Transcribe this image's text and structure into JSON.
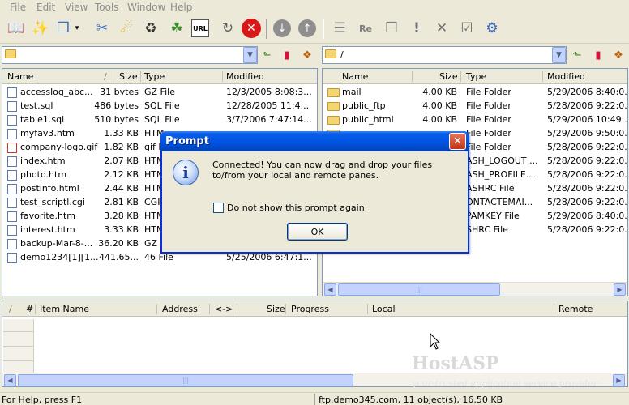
{
  "menu": [
    "File",
    "Edit",
    "View",
    "Tools",
    "Window",
    "Help"
  ],
  "toolbar_icons": [
    "connect-icon",
    "wizard-icon",
    "new-icon",
    "disconnect-icon",
    "stop-link-icon",
    "sync-icon",
    "browse-icon",
    "url-icon",
    "refresh-icon",
    "abort-icon",
    "download-icon",
    "upload-icon",
    "properties-icon",
    "rename-icon",
    "newfolder-icon",
    "exclamation-icon",
    "delete-icon",
    "check-icon",
    "settings-icon"
  ],
  "local": {
    "path": "",
    "columns": {
      "name": "Name",
      "sort": "/",
      "size": "Size",
      "type": "Type",
      "modified": "Modified"
    },
    "files": [
      {
        "name": "accesslog_abc...",
        "size": "31 bytes",
        "type": "GZ File",
        "modified": "12/3/2005 8:08:3...",
        "icon": "file"
      },
      {
        "name": "test.sql",
        "size": "486 bytes",
        "type": "SQL File",
        "modified": "12/28/2005 11:4...",
        "icon": "file"
      },
      {
        "name": "table1.sql",
        "size": "510 bytes",
        "type": "SQL File",
        "modified": "3/7/2006 7:47:14...",
        "icon": "file"
      },
      {
        "name": "myfav3.htm",
        "size": "1.33 KB",
        "type": "HTM",
        "modified": "",
        "icon": "html"
      },
      {
        "name": "company-logo.gif",
        "size": "1.82 KB",
        "type": "gif I",
        "modified": "",
        "icon": "gif"
      },
      {
        "name": "index.htm",
        "size": "2.07 KB",
        "type": "HTM",
        "modified": "",
        "icon": "html"
      },
      {
        "name": "photo.htm",
        "size": "2.12 KB",
        "type": "HTM",
        "modified": "",
        "icon": "html"
      },
      {
        "name": "postinfo.html",
        "size": "2.44 KB",
        "type": "HTM",
        "modified": "",
        "icon": "html"
      },
      {
        "name": "test_scriptl.cgi",
        "size": "2.81 KB",
        "type": "CGI",
        "modified": "",
        "icon": "file"
      },
      {
        "name": "favorite.htm",
        "size": "3.28 KB",
        "type": "HTM",
        "modified": "",
        "icon": "html"
      },
      {
        "name": "interest.htm",
        "size": "3.33 KB",
        "type": "HTM",
        "modified": "",
        "icon": "html"
      },
      {
        "name": "backup-Mar-8-...",
        "size": "36.20 KB",
        "type": "GZ F",
        "modified": "",
        "icon": "file"
      },
      {
        "name": "demo1234[1][1...",
        "size": "441.65...",
        "type": "46 File",
        "modified": "5/25/2006 6:47:1...",
        "icon": "file"
      }
    ]
  },
  "remote": {
    "path": "/",
    "columns": {
      "name": "Name",
      "sort": "/",
      "size": "Size",
      "type": "Type",
      "modified": "Modified"
    },
    "files": [
      {
        "name": "mail",
        "size": "4.00 KB",
        "type": "File Folder",
        "modified": "5/29/2006 8:40:0..."
      },
      {
        "name": "public_ftp",
        "size": "4.00 KB",
        "type": "File Folder",
        "modified": "5/28/2006 9:22:0..."
      },
      {
        "name": "public_html",
        "size": "4.00 KB",
        "type": "File Folder",
        "modified": "5/29/2006 10:49:..."
      },
      {
        "name": "",
        "size": "",
        "type": "File Folder",
        "modified": "5/29/2006 9:50:0..."
      },
      {
        "name": "",
        "size": "",
        "type": "File Folder",
        "modified": "5/28/2006 9:22:0..."
      },
      {
        "name": "",
        "size": "",
        "type": "ASH_LOGOUT ...",
        "modified": "5/28/2006 9:22:0..."
      },
      {
        "name": "",
        "size": "",
        "type": "ASH_PROFILE...",
        "modified": "5/28/2006 9:22:0..."
      },
      {
        "name": "",
        "size": "",
        "type": "ASHRC File",
        "modified": "5/28/2006 9:22:0..."
      },
      {
        "name": "",
        "size": "",
        "type": "ONTACTEMAI...",
        "modified": "5/28/2006 9:22:0..."
      },
      {
        "name": "",
        "size": "",
        "type": "PAMKEY File",
        "modified": "5/29/2006 8:40:0..."
      },
      {
        "name": "",
        "size": "",
        "type": "SHRC File",
        "modified": "5/28/2006 9:22:0..."
      }
    ]
  },
  "queue": {
    "columns": {
      "flag": "/",
      "num": "#",
      "item": "Item Name",
      "address": "Address",
      "dir": "<->",
      "size": "Size",
      "progress": "Progress",
      "local": "Local",
      "remote": "Remote"
    }
  },
  "status": {
    "help": "For Help, press F1",
    "connection": "ftp.demo345.com, 11 object(s), 16.50 KB"
  },
  "watermark": {
    "brand": "HostASP",
    "tagline": "your trusted application service provider"
  },
  "dialog": {
    "title": "Prompt",
    "message": "Connected! You can now drag and drop your files to/from your local and remote panes.",
    "checkbox_label": "Do not show this prompt again",
    "checkbox_checked": false,
    "ok_label": "OK"
  }
}
